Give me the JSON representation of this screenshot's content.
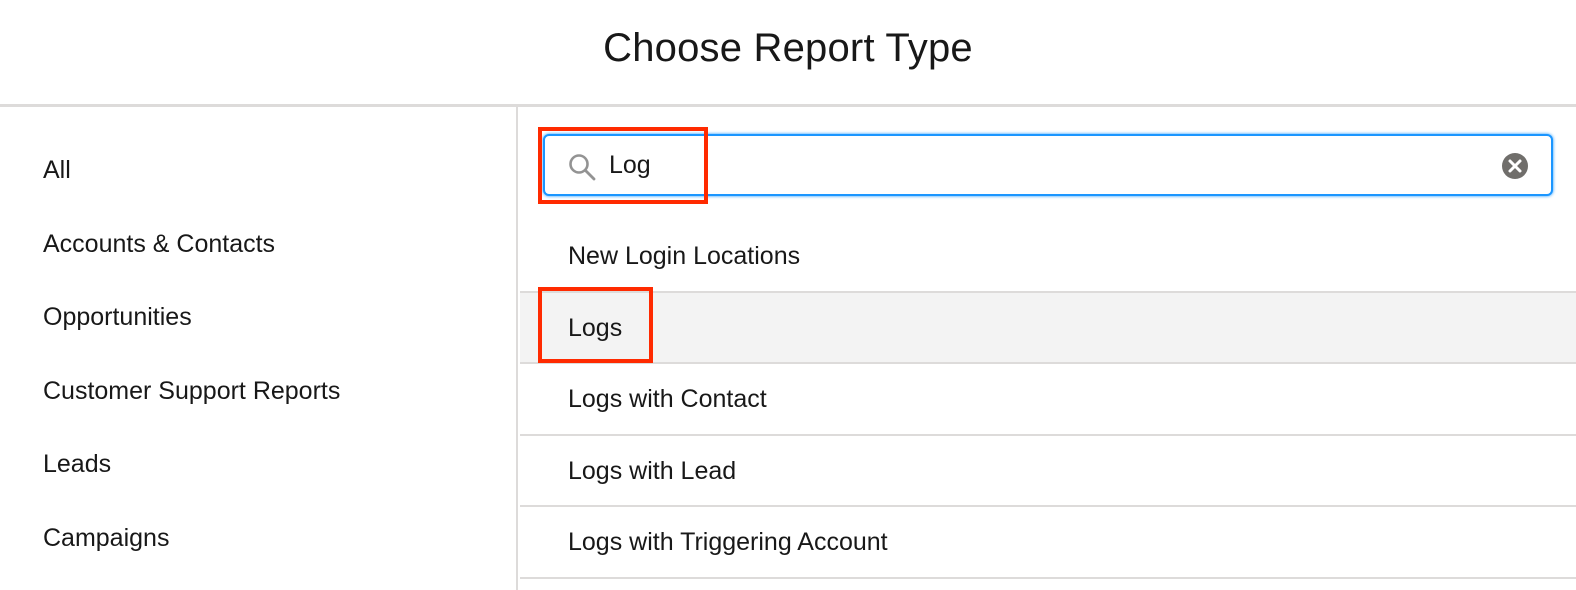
{
  "header": {
    "title": "Choose Report Type"
  },
  "sidebar": {
    "items": [
      {
        "label": "All"
      },
      {
        "label": "Accounts & Contacts"
      },
      {
        "label": "Opportunities"
      },
      {
        "label": "Customer Support Reports"
      },
      {
        "label": "Leads"
      },
      {
        "label": "Campaigns"
      }
    ]
  },
  "search": {
    "value": "Log",
    "search_icon": "search-icon",
    "clear_icon": "clear-icon"
  },
  "results": [
    {
      "label": "New Login Locations"
    },
    {
      "label": "Logs"
    },
    {
      "label": "Logs with Contact"
    },
    {
      "label": "Logs with Lead"
    },
    {
      "label": "Logs with Triggering Account"
    }
  ],
  "colors": {
    "accent": "#1b96ff",
    "highlight": "#ff2a00",
    "selected_row": "#f3f3f3"
  }
}
